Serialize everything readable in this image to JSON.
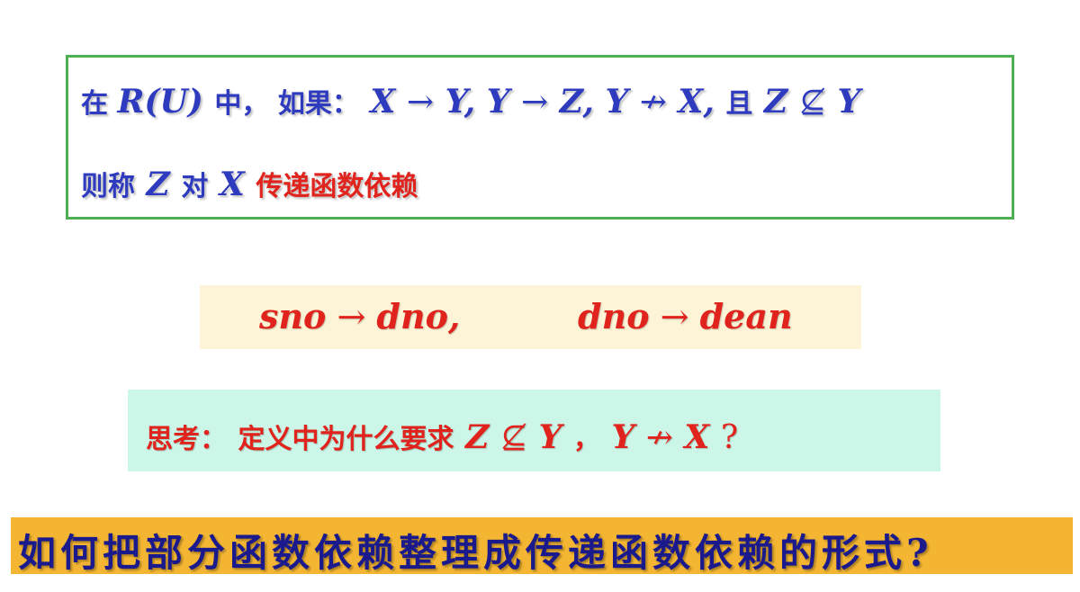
{
  "definition": {
    "line1": {
      "prefix": "在 ",
      "relation": "R(U)",
      "mid": "中， 如果：",
      "fd1_lhs": "X",
      "arrow1": "→",
      "fd1_rhs": "Y,",
      "fd2_lhs": "Y",
      "arrow2": "→",
      "fd2_rhs": "Z,",
      "fd3_lhs": "Y",
      "arrow3": "↛",
      "fd3_rhs": "X,",
      "conj": "且",
      "sub_lhs": "Z",
      "notsubset": "⊈",
      "sub_rhs": "Y"
    },
    "line2": {
      "prefix": "则称",
      "z": "Z",
      "mid": "对",
      "x": "X",
      "term": "传递函数依赖"
    }
  },
  "example": {
    "fd1_lhs": "sno",
    "arrow1": "→",
    "fd1_rhs": "dno,",
    "fd2_lhs": "dno",
    "arrow2": "→",
    "fd2_rhs": "dean"
  },
  "thinking": {
    "label": "思考：",
    "question": "定义中为什么要求",
    "z": "Z",
    "notsubset": "⊈",
    "y1": "Y",
    "sep": "，",
    "y2": "Y",
    "arrow": "↛",
    "x": "X",
    "qmark": "?"
  },
  "question": {
    "text": "如何把部分函数依赖整理成传递函数依赖的形式?"
  },
  "colors": {
    "definition_text": "#2f3bbf",
    "highlight_red": "#e0231c",
    "definition_border": "#4caf50",
    "example_bg": "#fdf3d6",
    "thinking_bg": "#ccf7e8",
    "question_bg": "#f3b532",
    "question_text": "#1a1a8c"
  }
}
